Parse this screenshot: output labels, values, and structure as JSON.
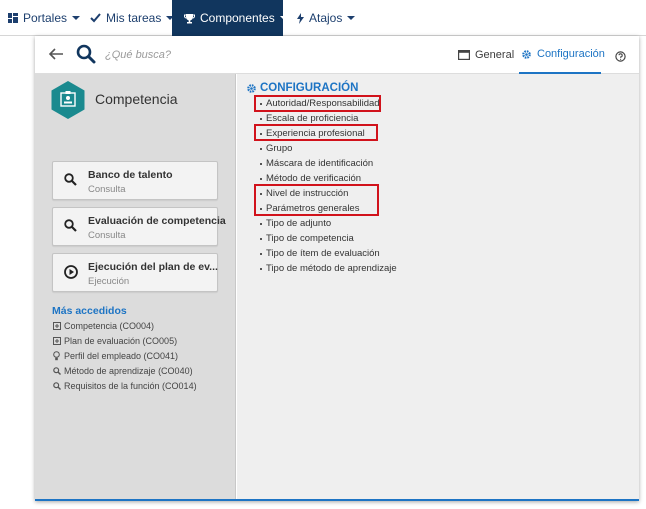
{
  "nav": {
    "items": [
      {
        "label": "Portales",
        "icon": "grid-icon"
      },
      {
        "label": "Mis tareas",
        "icon": "check-icon"
      },
      {
        "label": "Componentes",
        "icon": "trophy-icon",
        "active": true
      },
      {
        "label": "Atajos",
        "icon": "bolt-icon"
      }
    ]
  },
  "search": {
    "placeholder": "¿Qué busca?"
  },
  "tabs": [
    {
      "label": "General",
      "icon": "window-icon"
    },
    {
      "label": "Configuración",
      "icon": "gear-icon",
      "active": true
    }
  ],
  "component": {
    "title": "Competencia",
    "icon": "badge-hexagon-icon"
  },
  "cards": [
    {
      "title": "Banco de talento",
      "subtitle": "Consulta",
      "icon": "search-icon"
    },
    {
      "title": "Evaluación de competencia",
      "subtitle": "Consulta",
      "icon": "search-icon"
    },
    {
      "title": "Ejecución del plan de ev...",
      "subtitle": "Ejecución",
      "icon": "play-circle-icon"
    }
  ],
  "most_accessed": {
    "title": "Más accedidos",
    "items": [
      {
        "label": "Competencia (CO004)",
        "icon": "plus-square-icon"
      },
      {
        "label": "Plan de evaluación (CO005)",
        "icon": "plus-square-icon"
      },
      {
        "label": "Perfil del empleado (CO041)",
        "icon": "bulb-icon"
      },
      {
        "label": "Método de aprendizaje (CO040)",
        "icon": "search-icon"
      },
      {
        "label": "Requisitos de la función (CO014)",
        "icon": "search-icon"
      }
    ]
  },
  "config": {
    "title": "CONFIGURACIÓN",
    "items": [
      {
        "label": "Autoridad/Responsabilidad",
        "highlighted": true
      },
      {
        "label": "Escala de proficiencia"
      },
      {
        "label": "Experiencia profesional",
        "highlighted": true
      },
      {
        "label": "Grupo"
      },
      {
        "label": "Máscara de identificación"
      },
      {
        "label": "Método de verificación"
      },
      {
        "label": "Nivel de instrucción",
        "highlighted": true
      },
      {
        "label": "Parámetros generales",
        "highlighted": true
      },
      {
        "label": "Tipo de adjunto"
      },
      {
        "label": "Tipo de competencia"
      },
      {
        "label": "Tipo de ítem de evaluación"
      },
      {
        "label": "Tipo de método de aprendizaje"
      }
    ]
  },
  "colors": {
    "nav_active": "#11365e",
    "accent": "#1d74c4",
    "highlight": "#d1121b",
    "hexagon": "#1a8a8f"
  }
}
